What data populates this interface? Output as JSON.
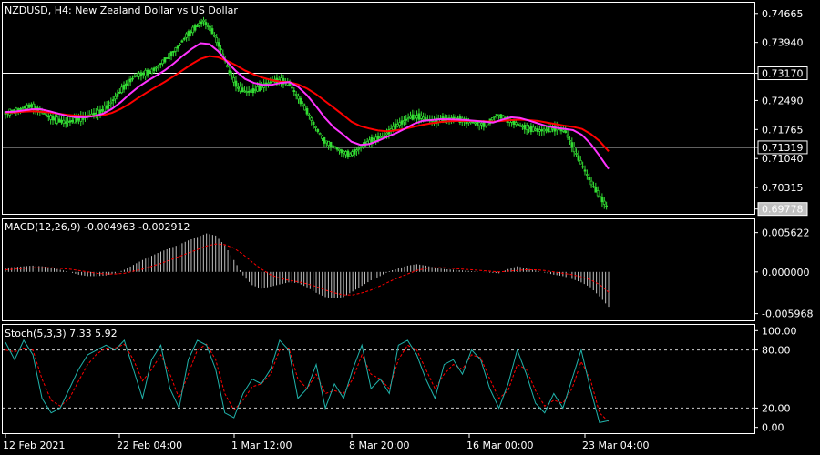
{
  "colors": {
    "background": "#000000",
    "foreground": "#ffffff",
    "candle": "#33dd33",
    "ma_fast": "#ff33ff",
    "ma_slow": "#ff0000",
    "macd_hist": "#c0c0c0",
    "macd_signal": "#ff0000",
    "stoch_main": "#20b2aa",
    "stoch_signal": "#ff0000",
    "grid": "#ffffff"
  },
  "chart_data": [
    {
      "panel": "price",
      "type": "line",
      "title": "NZDUSD, H4:  New Zealand Dollar vs US Dollar",
      "y_ticks": [
        "0.74665",
        "0.73940",
        "0.73170",
        "0.72490",
        "0.71765",
        "0.71319",
        "0.71040",
        "0.70315",
        "0.69778"
      ],
      "y_tick_values": [
        0.74665,
        0.7394,
        0.7317,
        0.7249,
        0.71765,
        0.71319,
        0.7104,
        0.70315,
        0.69778
      ],
      "ylim": [
        0.6968,
        0.7491
      ],
      "hlines": [
        0.7317,
        0.71319
      ],
      "hline_labels": [
        "0.73170",
        "0.71319"
      ],
      "current_price": "0.69778",
      "close": [
        0.7218,
        0.7222,
        0.723,
        0.7236,
        0.7224,
        0.7209,
        0.72,
        0.7194,
        0.7199,
        0.7205,
        0.7213,
        0.722,
        0.7237,
        0.7262,
        0.7289,
        0.7309,
        0.7316,
        0.7322,
        0.7341,
        0.736,
        0.7382,
        0.7411,
        0.743,
        0.7448,
        0.7422,
        0.7378,
        0.732,
        0.7281,
        0.727,
        0.7275,
        0.7286,
        0.7298,
        0.73,
        0.7289,
        0.7256,
        0.7222,
        0.7182,
        0.7149,
        0.7135,
        0.7122,
        0.7113,
        0.7128,
        0.7144,
        0.7153,
        0.7161,
        0.718,
        0.7194,
        0.7207,
        0.7209,
        0.72,
        0.7198,
        0.7202,
        0.7204,
        0.72,
        0.7195,
        0.719,
        0.7191,
        0.7215,
        0.7204,
        0.7194,
        0.7184,
        0.7178,
        0.7174,
        0.7176,
        0.718,
        0.7171,
        0.7127,
        0.7084,
        0.7043,
        0.7009,
        0.6978
      ],
      "series": [
        {
          "values": [
            0.722,
            0.7221,
            0.7224,
            0.7227,
            0.7227,
            0.7222,
            0.7216,
            0.721,
            0.7207,
            0.7207,
            0.721,
            0.7216,
            0.7228,
            0.7245,
            0.7265,
            0.7283,
            0.7298,
            0.7311,
            0.7325,
            0.7342,
            0.7361,
            0.7378,
            0.7392,
            0.739,
            0.7372,
            0.7345,
            0.7322,
            0.7303,
            0.7293,
            0.7288,
            0.7288,
            0.7293,
            0.7295,
            0.7283,
            0.7262,
            0.7235,
            0.7206,
            0.7182,
            0.7165,
            0.7146,
            0.7138,
            0.714,
            0.7148,
            0.7158,
            0.7167,
            0.7178,
            0.719,
            0.7198,
            0.72,
            0.7202,
            0.7202,
            0.7201,
            0.72,
            0.7198,
            0.7196,
            0.7194,
            0.7201,
            0.7207,
            0.7205,
            0.7199,
            0.7192,
            0.7185,
            0.7181,
            0.7178,
            0.7175,
            0.7163,
            0.714,
            0.711,
            0.7078
          ]
        },
        {
          "values": [
            0.7219,
            0.7219,
            0.7221,
            0.7222,
            0.7221,
            0.7219,
            0.7216,
            0.7213,
            0.7211,
            0.721,
            0.721,
            0.7212,
            0.7218,
            0.7228,
            0.7241,
            0.7256,
            0.727,
            0.7283,
            0.7296,
            0.731,
            0.7325,
            0.734,
            0.7353,
            0.736,
            0.7357,
            0.7348,
            0.7337,
            0.7324,
            0.7314,
            0.7306,
            0.73,
            0.7296,
            0.7295,
            0.7289,
            0.7279,
            0.7265,
            0.7248,
            0.7231,
            0.7214,
            0.7196,
            0.7185,
            0.7179,
            0.7174,
            0.7172,
            0.7174,
            0.7178,
            0.7183,
            0.7188,
            0.7192,
            0.7195,
            0.7197,
            0.7198,
            0.7198,
            0.7198,
            0.7197,
            0.7196,
            0.7198,
            0.72,
            0.7201,
            0.72,
            0.7198,
            0.7194,
            0.719,
            0.7186,
            0.7183,
            0.7178,
            0.7165,
            0.7147,
            0.7122
          ]
        }
      ]
    },
    {
      "panel": "macd",
      "type": "bar",
      "title": "MACD(12,26,9) -0.004963 -0.002912",
      "y_ticks": [
        "0.005622",
        "0.000000",
        "-0.005968"
      ],
      "y_tick_values": [
        0.005622,
        0.0,
        -0.005968
      ],
      "ylim": [
        -0.0068,
        0.0074
      ],
      "histogram": [
        0.0006,
        0.0007,
        0.0008,
        0.0009,
        0.0008,
        0.0006,
        0.0003,
        0.0,
        -0.0004,
        -0.0006,
        -0.0006,
        -0.0005,
        -0.0002,
        0.0003,
        0.001,
        0.0017,
        0.0023,
        0.0029,
        0.0034,
        0.0039,
        0.0045,
        0.005,
        0.0055,
        0.0052,
        0.0038,
        0.0017,
        -0.0005,
        -0.0019,
        -0.0024,
        -0.0021,
        -0.0018,
        -0.0015,
        -0.0016,
        -0.0022,
        -0.003,
        -0.0036,
        -0.0038,
        -0.0036,
        -0.0028,
        -0.002,
        -0.0012,
        -0.0006,
        0.0001,
        0.0005,
        0.0009,
        0.0011,
        0.0009,
        0.0006,
        0.0004,
        0.0003,
        0.0002,
        0.0001,
        0.0,
        -0.0001,
        -0.0002,
        0.0004,
        0.0008,
        0.0005,
        0.0002,
        -0.0001,
        -0.0004,
        -0.0006,
        -0.001,
        -0.0015,
        -0.0022,
        -0.0035,
        -0.005
      ],
      "signal": [
        0.0003,
        0.0004,
        0.0005,
        0.0006,
        0.0006,
        0.0006,
        0.0005,
        0.0004,
        0.0002,
        0.0,
        -0.0002,
        -0.0003,
        -0.0003,
        -0.0002,
        0.0001,
        0.0004,
        0.0008,
        0.0012,
        0.0017,
        0.0022,
        0.0027,
        0.0032,
        0.0037,
        0.004,
        0.0039,
        0.0034,
        0.0025,
        0.0014,
        0.0004,
        -0.0004,
        -0.0009,
        -0.0012,
        -0.0014,
        -0.0017,
        -0.0021,
        -0.0026,
        -0.003,
        -0.0033,
        -0.0033,
        -0.003,
        -0.0026,
        -0.002,
        -0.0014,
        -0.0008,
        -0.0003,
        0.0002,
        0.0005,
        0.0006,
        0.0006,
        0.0005,
        0.0004,
        0.0003,
        0.0002,
        0.0001,
        0.0,
        0.0001,
        0.0002,
        0.0003,
        0.0003,
        0.0002,
        0.0,
        -0.0002,
        -0.0004,
        -0.0007,
        -0.0011,
        -0.0018,
        -0.0029
      ]
    },
    {
      "panel": "stochastic",
      "type": "line",
      "title": "Stoch(5,3,3) 7.33 5.92",
      "y_ticks": [
        "100.00",
        "80.00",
        "20.00",
        "0.00"
      ],
      "y_tick_values": [
        100,
        80,
        20,
        0
      ],
      "ylim": [
        -5,
        105
      ],
      "hlines": [
        80,
        20
      ],
      "series": [
        {
          "values": [
            88,
            70,
            90,
            75,
            30,
            15,
            20,
            40,
            60,
            75,
            80,
            85,
            80,
            90,
            60,
            30,
            70,
            85,
            40,
            20,
            70,
            90,
            85,
            60,
            15,
            10,
            35,
            50,
            45,
            60,
            90,
            80,
            30,
            40,
            65,
            20,
            45,
            30,
            60,
            85,
            40,
            50,
            35,
            85,
            90,
            75,
            50,
            30,
            65,
            70,
            55,
            80,
            70,
            40,
            20,
            45,
            80,
            55,
            25,
            15,
            35,
            20,
            50,
            80,
            40,
            5,
            7
          ]
        },
        {
          "values": [
            80,
            78,
            82,
            80,
            50,
            28,
            22,
            30,
            48,
            65,
            76,
            82,
            82,
            86,
            70,
            48,
            60,
            75,
            55,
            30,
            55,
            80,
            86,
            70,
            35,
            18,
            28,
            42,
            45,
            55,
            80,
            82,
            50,
            40,
            55,
            35,
            38,
            35,
            50,
            75,
            55,
            50,
            40,
            70,
            85,
            80,
            60,
            40,
            55,
            65,
            60,
            75,
            72,
            50,
            30,
            38,
            65,
            60,
            38,
            22,
            28,
            25,
            40,
            68,
            50,
            15,
            6
          ]
        }
      ]
    }
  ],
  "x_axis": {
    "labels": [
      "12 Feb 2021",
      "22 Feb 04:00",
      "1 Mar 12:00",
      "8 Mar 20:00",
      "16 Mar 00:00",
      "23 Mar 04:00"
    ]
  }
}
